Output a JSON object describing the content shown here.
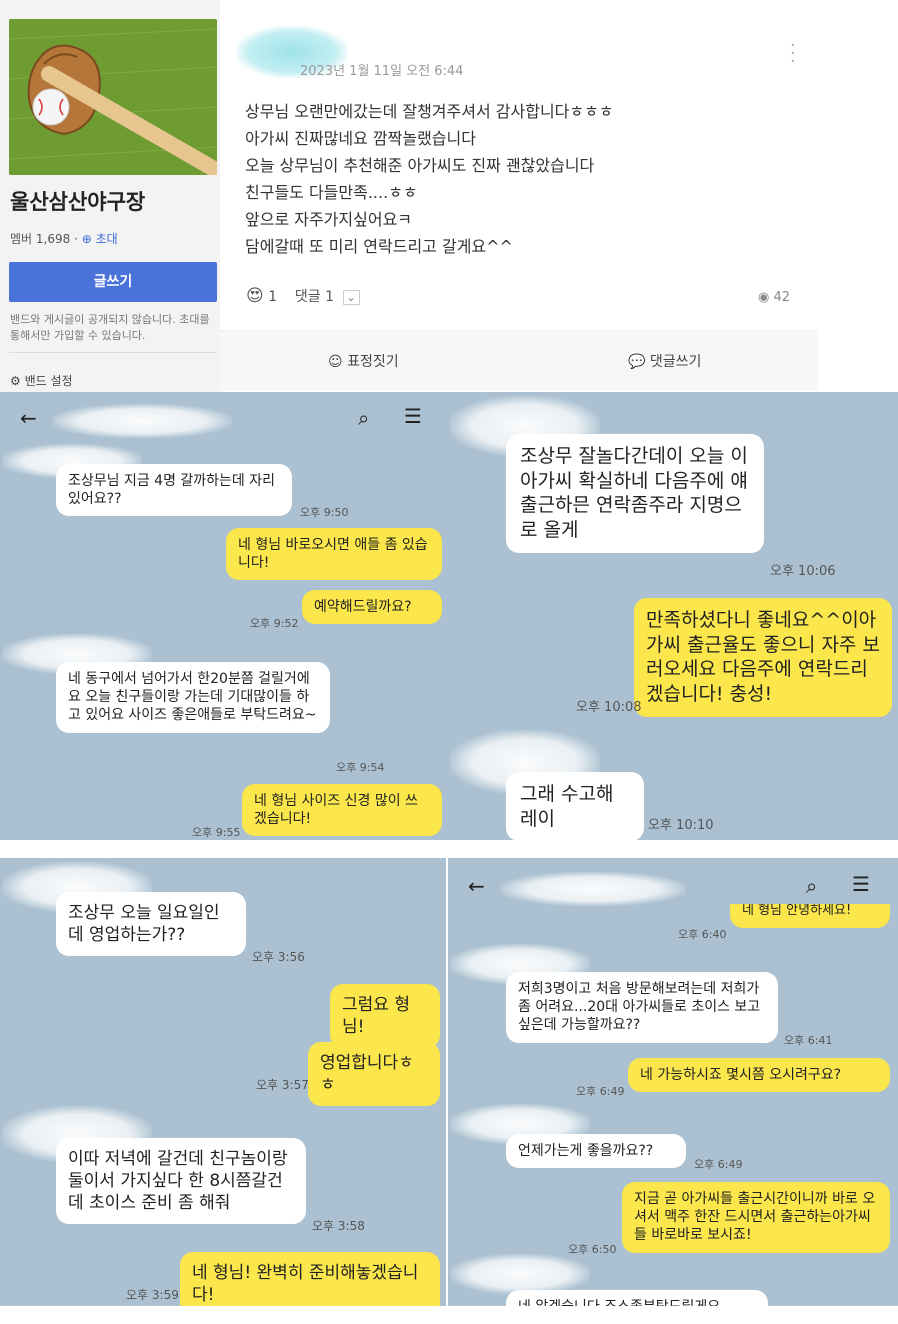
{
  "band": {
    "name": "울산삼산야구장",
    "members_label": "멤버 1,698 ·",
    "invite_label": "초대",
    "write_button": "글쓰기",
    "notice": "밴드와 게시글이 공개되지 않습니다. 초대를 통해서만 가입할 수 있습니다.",
    "settings_label": "밴드 설정"
  },
  "post": {
    "date": "2023년 1월 11일 오전 6:44",
    "lines": [
      "상무님 오랜만에갔는데 잘챙겨주셔서 감사합니다ㅎㅎㅎ",
      "아가씨 진짜많네요 깜짝놀랬습니다",
      "오늘 상무님이 추천해준 아가씨도 진짜 괜찮았습니다",
      "친구들도 다들만족....ㅎㅎ",
      "앞으로 자주가지싶어요ㅋ",
      "담에갈때 또 미리 연락드리고 갈게요^^"
    ],
    "reaction_count": "1",
    "comment_label": "댓글 1",
    "views": "42",
    "action_emotion": "표정짓기",
    "action_comment": "댓글쓰기"
  },
  "chat1": {
    "messages": [
      {
        "text": "조상무님 지금 4명 갈까하는데 자리있어요??",
        "time": "오후 9:50"
      },
      {
        "text": "네 형님 바로오시면 애들 좀 있습니다!",
        "time": ""
      },
      {
        "text": "예약해드릴까요?",
        "time": "오후 9:52"
      },
      {
        "text": "네 동구에서 넘어가서 한20분쯤 걸릴거에요 오늘 친구들이랑 가는데 기대많이들 하고 있어요 사이즈 좋은애들로 부탁드려요~",
        "time": "오후 9:54"
      },
      {
        "text": "네 형님 사이즈 신경 많이 쓰겠습니다!",
        "time": "오후 9:55"
      }
    ]
  },
  "chat2": {
    "messages": [
      {
        "text": "조상무 잘놀다간데이 오늘 이 아가씨 확실하네 다음주에 얘 출근하믄 연락좀주라 지명으로 올게",
        "time": "오후 10:06"
      },
      {
        "text": "만족하셨다니 좋네요^^이아가씨 출근율도 좋으니 자주 보러오세요 다음주에 연락드리겠습니다! 충성!",
        "time": "오후 10:08"
      },
      {
        "text": "그래 수고해레이",
        "time": "오후 10:10"
      }
    ]
  },
  "chat3": {
    "messages": [
      {
        "text": "조상무 오늘 일요일인데 영업하는가??",
        "time": "오후 3:56"
      },
      {
        "text": "그럼요 형님!",
        "time": ""
      },
      {
        "text": "영업합니다ㅎㅎ",
        "time": "오후 3:57"
      },
      {
        "text": "이따 저녁에 갈건데 친구놈이랑 둘이서 가지싶다 한 8시쯤갈건데 초이스 준비 좀 해줘",
        "time": "오후 3:58"
      },
      {
        "text": "네 형님! 완벽히 준비해놓겠습니다!",
        "time": "오후 3:59"
      }
    ]
  },
  "chat4": {
    "messages": [
      {
        "text": "네 형님 안녕하세요!",
        "time": "오후 6:40"
      },
      {
        "text": "저희3명이고 처음 방문해보려는데 저희가 좀 어려요...20대 아가씨들로 초이스 보고 싶은데 가능할까요??",
        "time": "오후 6:41"
      },
      {
        "text": "네 가능하시죠 몇시쯤 오시려구요?",
        "time": "오후 6:49"
      },
      {
        "text": "언제가는게 좋을까요??",
        "time": "오후 6:49"
      },
      {
        "text": "지금 곧 아가씨들 출근시간이니까 바로 오셔서 맥주 한잔 드시면서 출근하는아가씨들 바로바로 보시죠!",
        "time": "오후 6:50"
      },
      {
        "text": "네 알겠습니다 조스좀부탁드릴게요",
        "time": ""
      }
    ]
  },
  "icons": {
    "back": "back-arrow-icon",
    "search": "search-icon",
    "menu": "hamburger-menu-icon"
  },
  "colors": {
    "chat_bg": "#abc1d1",
    "my_bubble": "#fbe64b",
    "other_bubble": "#ffffff",
    "band_accent": "#4a73d9"
  }
}
